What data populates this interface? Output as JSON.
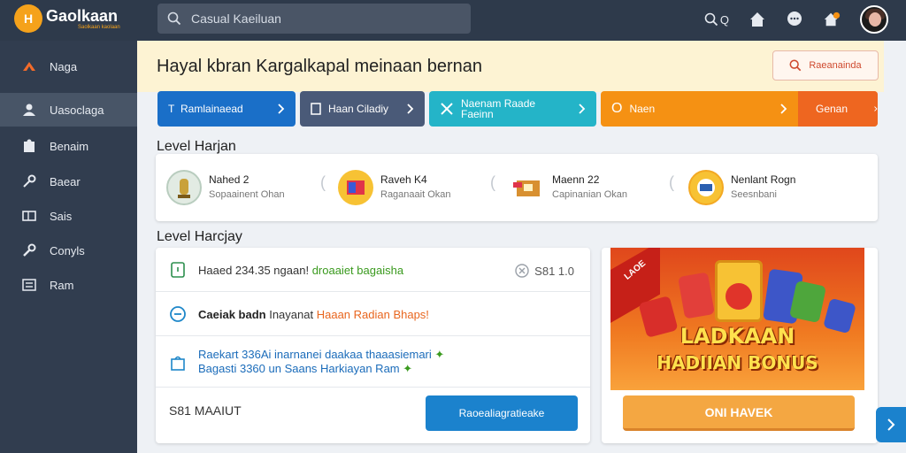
{
  "brand": {
    "name": "Gaolkaan",
    "tagline": "Saolkaan kaolaan",
    "badge": "H"
  },
  "search": {
    "placeholder": "Casual Kaeiluan"
  },
  "topbar": {
    "search_label": "Q",
    "icons": [
      "search-icon",
      "home-icon",
      "chat-icon",
      "notification-home-icon",
      "avatar"
    ]
  },
  "sidebar": {
    "items": [
      {
        "label": "Naga",
        "icon": "flame-icon"
      },
      {
        "label": "Uasoclaga",
        "icon": "users-icon"
      },
      {
        "label": "Benaim",
        "icon": "puzzle-icon"
      },
      {
        "label": "Baear",
        "icon": "key-icon"
      },
      {
        "label": "Sais",
        "icon": "card-icon"
      },
      {
        "label": "Conyls",
        "icon": "wrench-icon"
      },
      {
        "label": "Ram",
        "icon": "list-icon"
      }
    ]
  },
  "banner": {
    "title": "Hayal kbran Kargalkapal meinaan bernan",
    "button_label": "Raeanainda"
  },
  "quick_actions": [
    {
      "label": "Ramlainaead",
      "prefix": "T"
    },
    {
      "label": "Haan Ciladiy"
    },
    {
      "label": "Naenam Raade Faeinn"
    },
    {
      "label": "Naen",
      "prefix": "O",
      "extra_label": "Genan"
    }
  ],
  "levels_section": {
    "title": "Level Harjan",
    "items": [
      {
        "name": "Nahed 2",
        "sub": "Sopaainent Ohan"
      },
      {
        "name": "Raveh K4",
        "sub": "Raganaait Okan"
      },
      {
        "name": "Maenn 22",
        "sub": "Capinanian Okan"
      },
      {
        "name": "Nenlant Rogn",
        "sub": "Seesnbani"
      }
    ]
  },
  "tasks_section": {
    "title": "Level Harcjay",
    "rows": [
      {
        "text": "Haaed 234.35 ngaan!",
        "highlight": "droaaiet bagaisha",
        "value": "S81 1.0"
      },
      {
        "text": "Caeiak badn",
        "middle": "Inayanat",
        "highlight": "Haaan Radian Bhaps!"
      },
      {
        "line1": "Raekart 336Ai inarnanei daakaa thaaasiemari",
        "line2": "Bagasti 3360 un Saans Harkiayan Ram"
      }
    ],
    "footer_text": "S81 MAAIUT",
    "button_label": "Raoealiagratieake"
  },
  "promo": {
    "ribbon": "LAOE",
    "headline_1": "LADKAAN",
    "headline_2": "HADIIAN BONUS",
    "button_label": "ONI HAVEK"
  },
  "colors": {
    "topbar": "#2e3a4b",
    "sidebar": "#313d4f",
    "primary": "#1a6fc8",
    "accent": "#f59113",
    "banner": "#fdf3d3"
  }
}
